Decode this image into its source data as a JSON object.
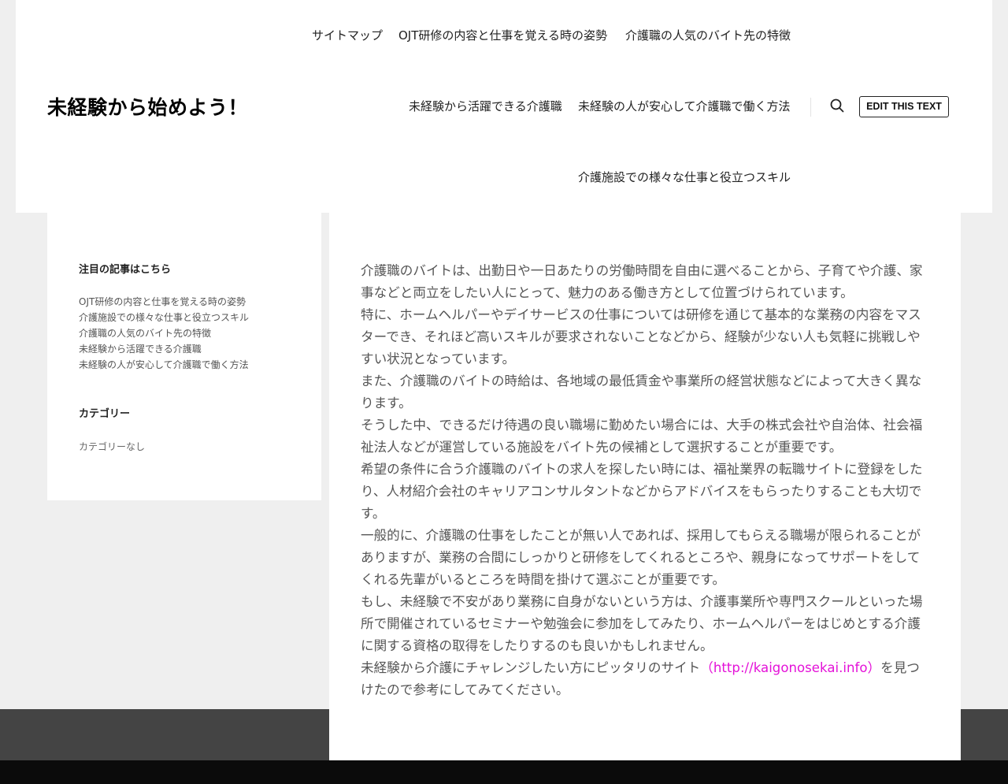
{
  "header": {
    "site_title": "未経験から始めよう！",
    "nav_top": [
      "サイトマップ",
      "OJT研修の内容と仕事を覚える時の姿勢",
      "介護職の人気のバイト先の特徴"
    ],
    "nav_main": [
      "未経験から活躍できる介護職",
      "未経験の人が安心して介護職で働く方法"
    ],
    "nav_bottom": [
      "介護施設での様々な仕事と役立つスキル"
    ],
    "search_icon": "search-icon",
    "edit_button_label": "EDIT THIS TEXT"
  },
  "sidebar": {
    "featured_title": "注目の記事はこちら",
    "featured_items": [
      "OJT研修の内容と仕事を覚える時の姿勢",
      "介護施設での様々な仕事と役立つスキル",
      "介護職の人気のバイト先の特徴",
      "未経験から活躍できる介護職",
      "未経験の人が安心して介護職で働く方法"
    ],
    "category_title": "カテゴリー",
    "category_empty": "カテゴリーなし"
  },
  "article": {
    "paragraphs": [
      "介護職のバイトは、出勤日や一日あたりの労働時間を自由に選べることから、子育てや介護、家事などと両立をしたい人にとって、魅力のある働き方として位置づけられています。",
      "特に、ホームヘルパーやデイサービスの仕事については研修を通じて基本的な業務の内容をマスターでき、それほど高いスキルが要求されないことなどから、経験が少ない人も気軽に挑戦しやすい状況となっています。",
      "また、介護職のバイトの時給は、各地域の最低賃金や事業所の経営状態などによって大きく異なります。",
      "そうした中、できるだけ待遇の良い職場に勤めたい場合には、大手の株式会社や自治体、社会福祉法人などが運営している施設をバイト先の候補として選択することが重要です。",
      "希望の条件に合う介護職のバイトの求人を探したい時には、福祉業界の転職サイトに登録をしたり、人材紹介会社のキャリアコンサルタントなどからアドバイスをもらったりすることも大切です。",
      "一般的に、介護職の仕事をしたことが無い人であれば、採用してもらえる職場が限られることがありますが、業務の合間にしっかりと研修をしてくれるところや、親身になってサポートをしてくれる先輩がいるところを時間を掛けて選ぶことが重要です。",
      "もし、未経験で不安があり業務に自身がないという方は、介護事業所や専門スクールといった場所で開催されているセミナーや勉強会に参加をしてみたり、ホームヘルパーをはじめとする介護に関する資格の取得をしたりするのも良いかもしれません。"
    ],
    "last_paragraph_before_link": "未経験から介護にチャレンジしたい方にピッタリのサイト",
    "link_text": "（http://kaigonosekai.info）",
    "last_paragraph_after_link": "を見つけたので参考にしてみてください。"
  },
  "colors": {
    "page_background": "#efefef",
    "link": "#e412d8",
    "footer_gray": "#444444",
    "footer_black": "#0b0b0b"
  }
}
